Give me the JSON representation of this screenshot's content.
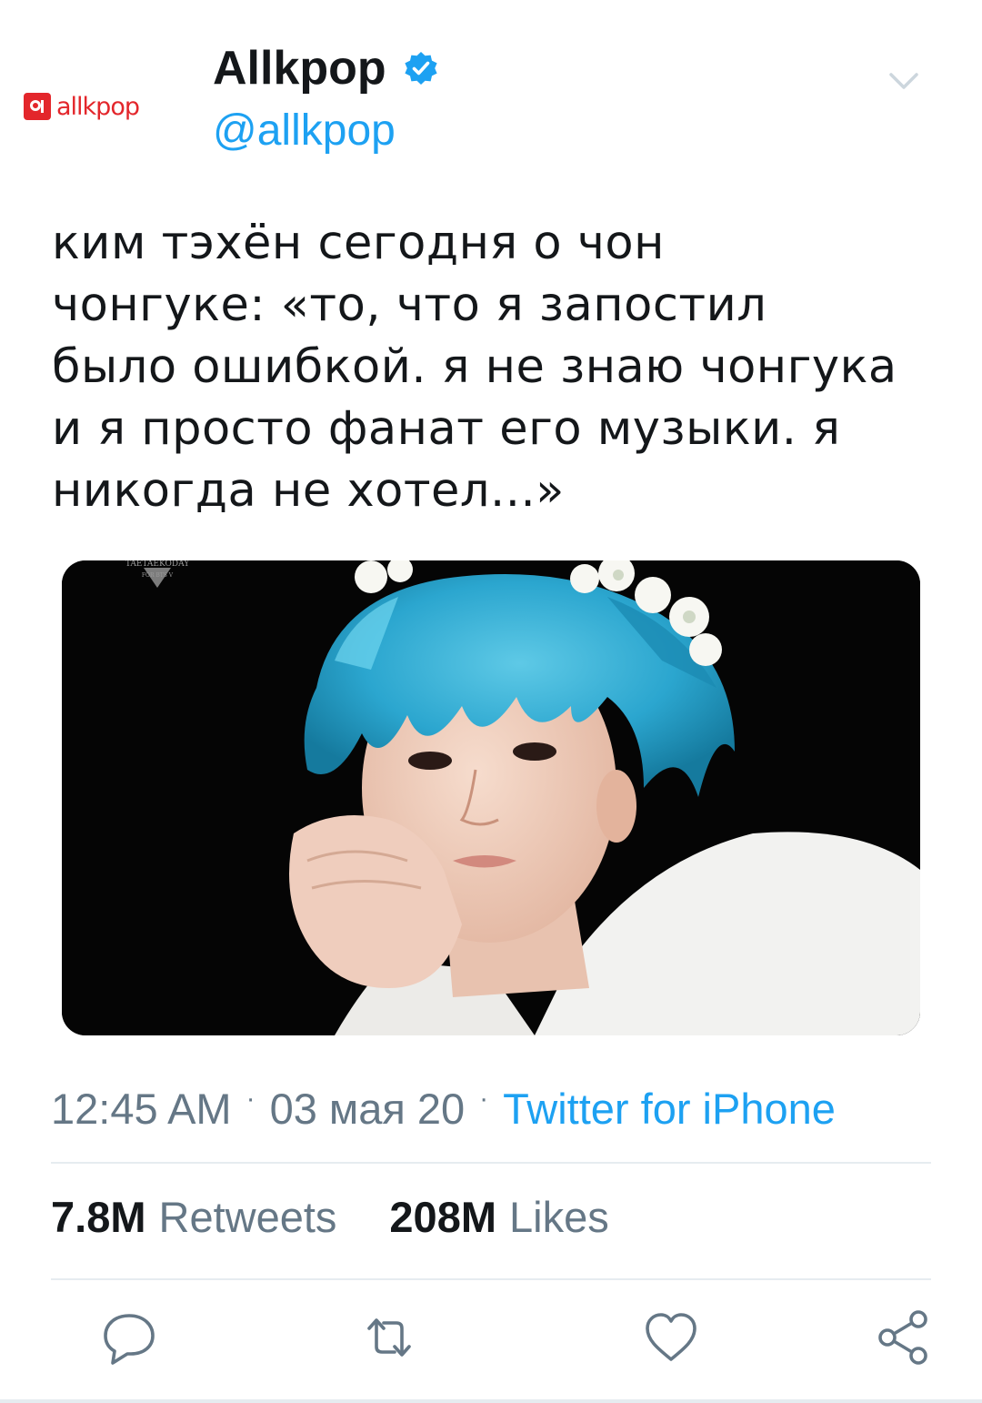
{
  "account": {
    "avatar_text": "allkpop",
    "display_name": "Allkpop",
    "handle": "@allkpop",
    "verified": true
  },
  "icons": {
    "verified": "verified-badge-icon",
    "menu": "chevron-down-icon",
    "reply": "reply-icon",
    "retweet": "retweet-icon",
    "like": "heart-icon",
    "share": "share-icon"
  },
  "tweet": {
    "text": "ким тэхён сегодня о чон\nчонгуке: «то, что я запостил\nбыло ошибкой. я не знаю чонгука\nи я просто фанат его музыки. я\nникогда не хотел...»",
    "image_caption": "TAETAEKODAY",
    "image_caption_sub": "FOR BTS V"
  },
  "meta": {
    "time": "12:45 AM",
    "separator": "·",
    "date": "03 мая 20",
    "source": "Twitter for iPhone"
  },
  "stats": {
    "retweets_count": "7.8M",
    "retweets_label": "Retweets",
    "likes_count": "208M",
    "likes_label": "Likes"
  },
  "colors": {
    "accent": "#1da1f2",
    "text": "#14171a",
    "muted": "#657786",
    "divider": "#e6ecf0",
    "brand_red": "#e3262b"
  }
}
